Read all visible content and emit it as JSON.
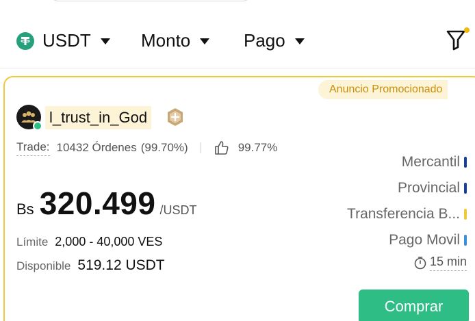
{
  "filters": {
    "asset": {
      "label": "USDT",
      "icon": "tether-icon"
    },
    "amount": {
      "label": "Monto"
    },
    "payment": {
      "label": "Pago"
    },
    "filter_icon": "funnel-icon",
    "filter_dot_color": "#f0b90b"
  },
  "ad": {
    "promo_badge": "Anuncio Promocionado",
    "merchant": {
      "name": "l_trust_in_God",
      "online": true,
      "badge_icon": "medal-icon"
    },
    "stats": {
      "trade_label": "Trade:",
      "orders": "10432 Órdenes",
      "completion": "(99.70%)",
      "positive_rate": "99.77%"
    },
    "price": {
      "currency": "Bs",
      "value": "320.499",
      "unit": "/USDT"
    },
    "limit": {
      "label": "Límite",
      "value": "2,000 - 40,000 VES"
    },
    "available": {
      "label": "Disponible",
      "value": "519.12 USDT"
    },
    "payment_methods": [
      {
        "name": "Mercantil",
        "color": "#1a3f8f"
      },
      {
        "name": "Provincial",
        "color": "#1a3f8f"
      },
      {
        "name": "Transferencia B...",
        "color": "#f0c93b"
      },
      {
        "name": "Pago Movil",
        "color": "#3b8fd9"
      }
    ],
    "time_limit": "15 min",
    "buy_label": "Comprar"
  },
  "colors": {
    "accent_green": "#2ebd85",
    "promo_border": "#f0c93b",
    "promo_bg": "#fdf3d6",
    "promo_text": "#c8900a"
  }
}
